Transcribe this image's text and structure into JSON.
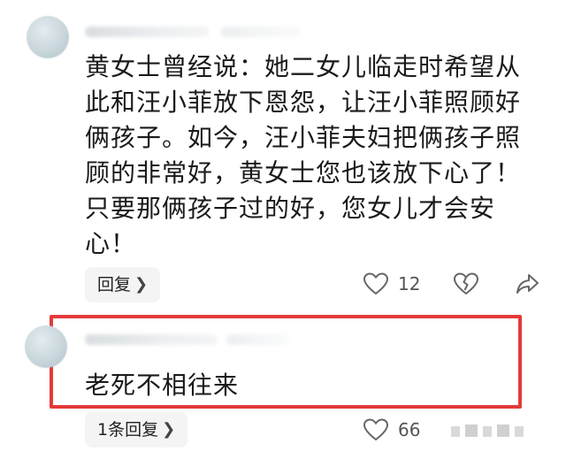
{
  "comments": [
    {
      "text": "黄女士曾经说：她二女儿临走时希望从\n此和汪小菲放下恩怨，让汪小菲照顾好\n俩孩子。如今，汪小菲夫妇把俩孩子照\n顾的非常好，黄女士您也该放下心了！\n只要那俩孩子过的好，您女儿才会安\n心！",
      "reply_label": "回复",
      "like_count": "12"
    },
    {
      "text": "老死不相往来",
      "reply_label": "1条回复",
      "like_count": "66"
    }
  ],
  "icons": {
    "chevron": "chevron-right-icon",
    "like": "heart-icon",
    "dislike": "broken-heart-icon",
    "share": "share-icon",
    "more": "more-icon"
  },
  "colors": {
    "highlight": "#e43a3a",
    "pill_bg": "#f4f4f5",
    "icon": "#666666"
  }
}
